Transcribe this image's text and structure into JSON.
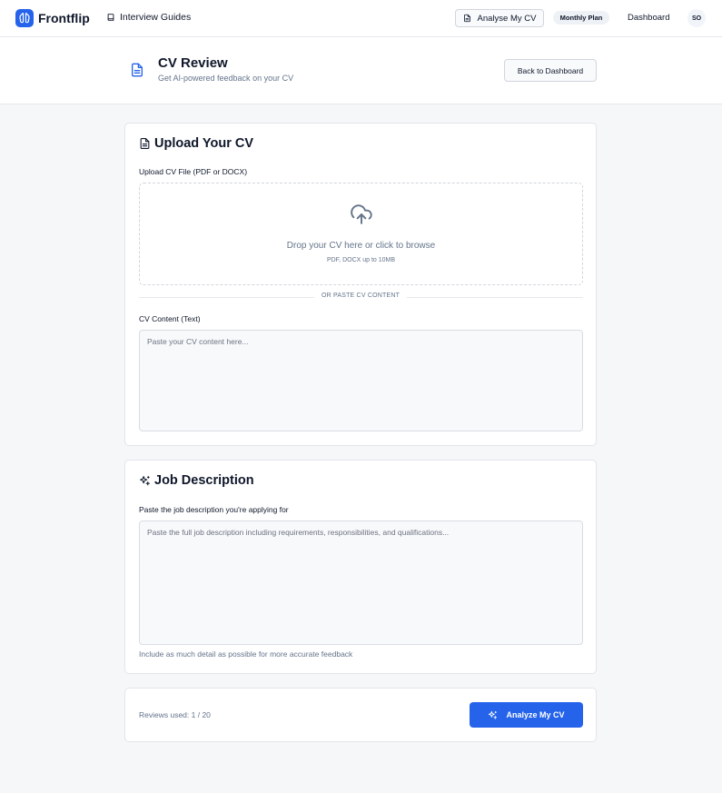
{
  "nav": {
    "brand": "Frontflip",
    "guides_label": "Interview Guides",
    "analyse_label": "Analyse My CV",
    "plan_badge": "Monthly Plan",
    "dashboard_label": "Dashboard",
    "avatar_initials": "SO"
  },
  "header": {
    "title": "CV Review",
    "subtitle": "Get AI-powered feedback on your CV",
    "back_label": "Back to Dashboard"
  },
  "upload": {
    "title": "Upload Your CV",
    "file_label": "Upload CV File (PDF or DOCX)",
    "drop_text": "Drop your CV here or click to browse",
    "drop_hint": "PDF, DOCX up to 10MB",
    "divider_text": "OR PASTE CV CONTENT",
    "content_label": "CV Content (Text)",
    "content_placeholder": "Paste your CV content here..."
  },
  "job": {
    "title": "Job Description",
    "label": "Paste the job description you're applying for",
    "placeholder": "Paste the full job description including requirements, responsibilities, and qualifications...",
    "hint": "Include as much detail as possible for more accurate feedback"
  },
  "footer": {
    "reviews_used": "Reviews used: 1 / 20",
    "analyze_label": "Analyze My CV"
  },
  "icons": {
    "brand": "brain-icon",
    "guides": "book-icon",
    "analyse": "document-icon",
    "upload": "cloud-upload-icon",
    "job": "sparkles-icon"
  },
  "colors": {
    "accent": "#2563eb",
    "background": "#f6f7f9",
    "muted_text": "#64748b"
  }
}
